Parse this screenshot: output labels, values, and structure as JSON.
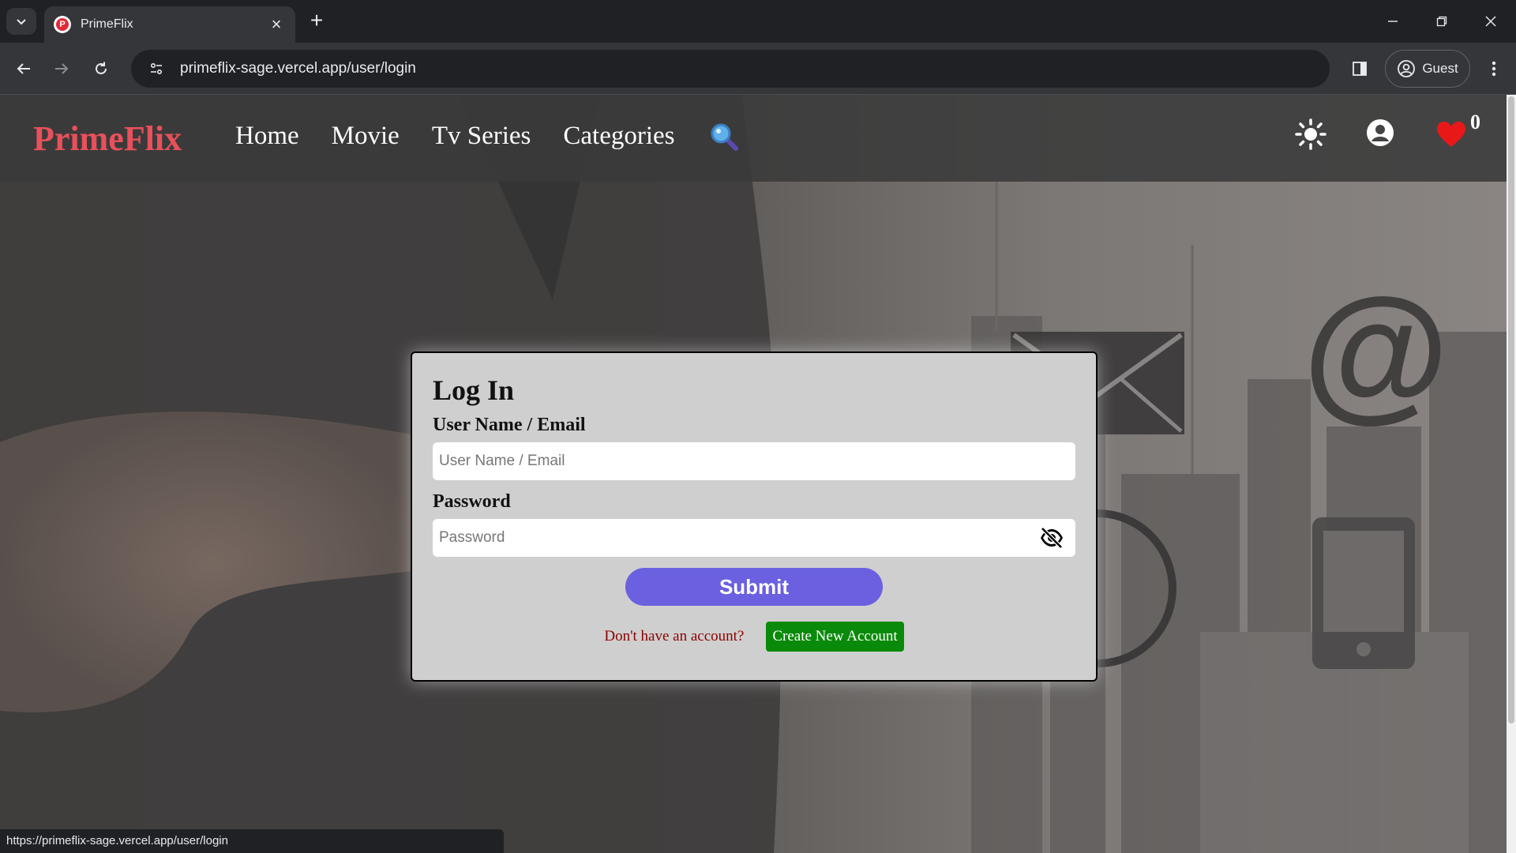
{
  "browser": {
    "tab_title": "PrimeFlix",
    "url": "primeflix-sage.vercel.app/user/login",
    "profile_label": "Guest",
    "status_url": "https://primeflix-sage.vercel.app/user/login"
  },
  "site": {
    "logo": "PrimeFlix",
    "nav": [
      "Home",
      "Movie",
      "Tv Series",
      "Categories"
    ],
    "favorites_count": "0",
    "brand_color": "#e8505b"
  },
  "login": {
    "title": "Log In",
    "username_label": "User Name / Email",
    "username_placeholder": "User Name / Email",
    "password_label": "Password",
    "password_placeholder": "Password",
    "submit_label": "Submit",
    "no_account_text": "Don't have an account?",
    "create_account_label": "Create New Account",
    "submit_color": "#6a60e0",
    "create_color": "#0a8a0a"
  }
}
